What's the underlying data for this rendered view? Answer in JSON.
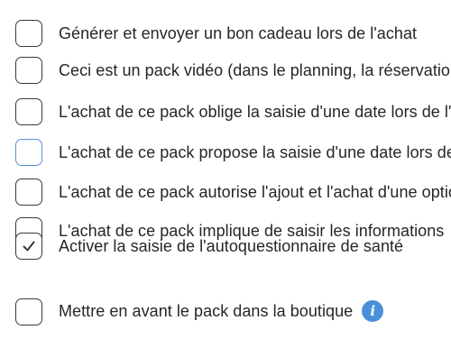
{
  "options": [
    {
      "label": "Générer et envoyer un bon cadeau lors de l'achat",
      "checked": false,
      "focused": false
    },
    {
      "label": "Ceci est un pack vidéo (dans le planning, la réservation",
      "checked": false,
      "focused": false
    },
    {
      "label": "L'achat de ce pack oblige la saisie d'une date lors de l'achat",
      "checked": false,
      "focused": false
    },
    {
      "label": "L'achat de ce pack propose la saisie d'une date lors de l'achat",
      "checked": false,
      "focused": true
    },
    {
      "label": "L'achat de ce pack autorise l'ajout et l'achat d'une option",
      "checked": false,
      "focused": false
    },
    {
      "label": "L'achat de ce pack implique de saisir les informations",
      "checked": false,
      "focused": false
    },
    {
      "label": "Activer la saisie de l'autoquestionnaire de santé",
      "checked": true,
      "focused": false
    },
    {
      "label": "Mettre en avant le pack dans la boutique",
      "checked": false,
      "focused": false
    }
  ],
  "info_icon": {
    "glyph": "i",
    "name": "info-icon",
    "color": "#4a90d9"
  },
  "colors": {
    "checkbox_border": "#3a3a3a",
    "checkbox_focus": "#5a8fd8",
    "checkmark": "#3a3a3a"
  }
}
